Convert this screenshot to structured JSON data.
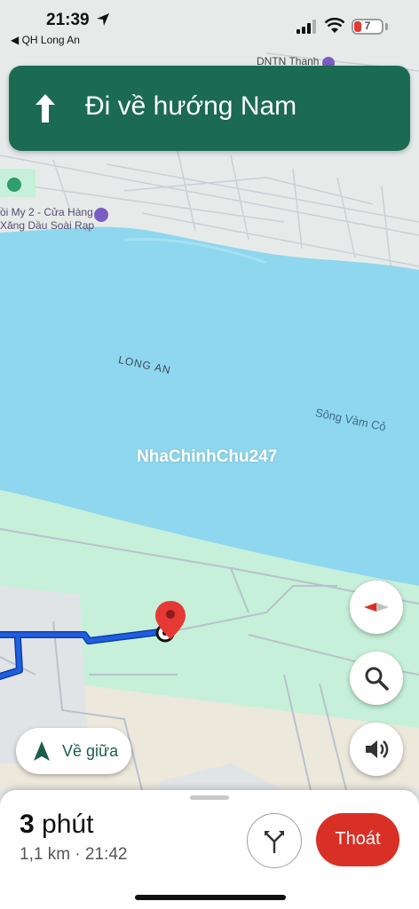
{
  "status_bar": {
    "time": "21:39",
    "back_label": "◀ QH Long An",
    "battery_level": "7"
  },
  "navigation": {
    "instruction": "Đi về hướng Nam",
    "direction_icon": "arrow-up-icon"
  },
  "map": {
    "poi_labels": [
      "DNTN Thanh",
      "ồi My 2 - Cửa Hàng",
      "Xăng Dầu Soài Rạp"
    ],
    "province_label": "LONG AN",
    "river_label": "Sông Vàm Cỏ",
    "watermark": "NhaChinhChu247"
  },
  "controls": {
    "recenter_label": "Về giữa",
    "compass_icon": "compass-icon",
    "search_icon": "search-icon",
    "sound_icon": "speaker-icon"
  },
  "trip": {
    "duration_value": "3",
    "duration_unit": " phút",
    "details": "1,1 km · 21:42",
    "exit_label": "Thoát",
    "routes_icon": "alternate-routes-icon"
  },
  "colors": {
    "nav_banner": "#1b6a52",
    "exit_button": "#d93025",
    "route_line": "#1e5fe0",
    "river": "#8fd7ee",
    "park": "#c6f0d9"
  }
}
